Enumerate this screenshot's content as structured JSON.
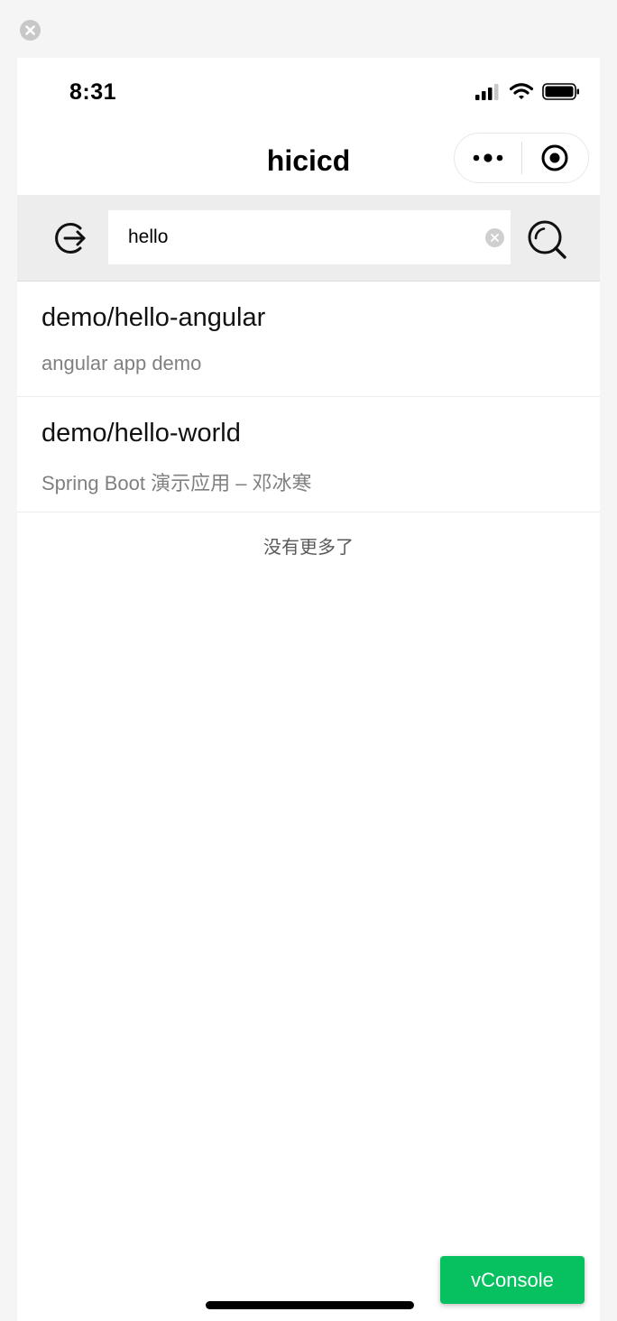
{
  "status_bar": {
    "time": "8:31"
  },
  "nav": {
    "title": "hicicd"
  },
  "search": {
    "value": "hello",
    "placeholder": ""
  },
  "results": [
    {
      "title": "demo/hello-angular",
      "description": "angular app demo"
    },
    {
      "title": "demo/hello-world",
      "description": "Spring Boot 演示应用 – 邓冰寒"
    }
  ],
  "no_more_text": "没有更多了",
  "vconsole_label": "vConsole",
  "colors": {
    "accent": "#07c160",
    "search_bg": "#ededed"
  }
}
